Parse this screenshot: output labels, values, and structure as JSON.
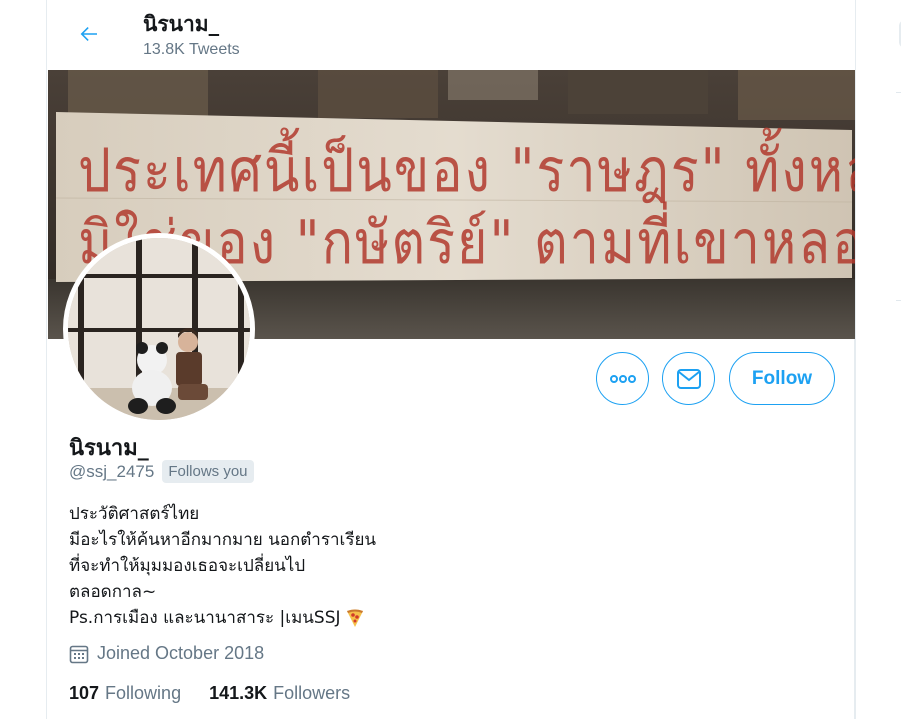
{
  "header": {
    "back_label": "back",
    "title": "นิรนาม_",
    "tweet_count": "13.8K Tweets"
  },
  "banner": {
    "line1": "ประเทศนี้เป็นของ \"ราษฎร\" ทั้งหลาย",
    "line2": "มิใช่ของ \"กษัตริย์\" ตามที่เขาหลอกลวง"
  },
  "actions": {
    "more_icon": "more-horizontal-icon",
    "message_icon": "envelope-icon",
    "follow_label": "Follow"
  },
  "profile": {
    "name": "นิรนาม_",
    "handle": "@ssj_2475",
    "follows_you": "Follows you",
    "bio": [
      "ประวัติศาสตร์ไทย",
      "มีอะไรให้ค้นหาอีกมากมาย นอกตำราเรียน",
      "ที่จะทำให้มุมมองเธอจะเปลี่ยนไป",
      "ตลอดกาล~",
      "Ps.การเมือง และนานาสาระ |เมนSSJ"
    ],
    "bio_emoji": "pizza-icon",
    "joined": "Joined October 2018",
    "calendar_icon": "calendar-icon"
  },
  "stats": {
    "following_count": "107",
    "following_label": "Following",
    "followers_count": "141.3K",
    "followers_label": "Followers"
  },
  "colors": {
    "accent": "#1da1f2",
    "secondary_text": "#657786",
    "banner_ink": "#b23a2e"
  }
}
